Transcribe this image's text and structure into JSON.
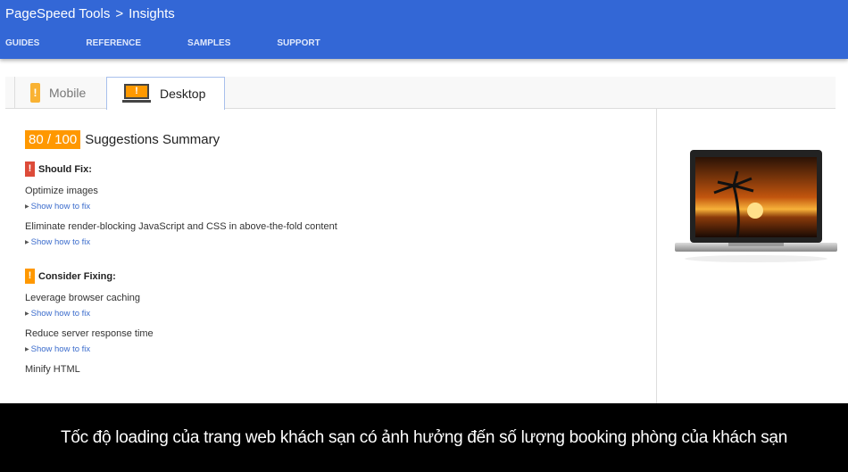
{
  "header": {
    "brand": "PageSpeed Tools",
    "separator": ">",
    "page": "Insights",
    "nav": [
      "GUIDES",
      "REFERENCE",
      "SAMPLES",
      "SUPPORT"
    ]
  },
  "tabs": [
    {
      "label": "Mobile",
      "icon": "phone-warning-icon"
    },
    {
      "label": "Desktop",
      "icon": "laptop-warning-icon",
      "active": true
    }
  ],
  "summary": {
    "score": "80 / 100",
    "title": "Suggestions Summary"
  },
  "should_fix": {
    "label": "Should Fix:",
    "color": "#dd4b39",
    "items": [
      "Optimize images",
      "Eliminate render-blocking JavaScript and CSS in above-the-fold content"
    ]
  },
  "consider_fixing": {
    "label": "Consider Fixing:",
    "color": "#ff9800",
    "items": [
      "Leverage browser caching",
      "Reduce server response time",
      "Minify HTML"
    ]
  },
  "show_fix": "Show how to fix",
  "caption": "Tốc độ loading của trang web khách sạn có ảnh hưởng đến số lượng booking phòng của khách sạn",
  "colors": {
    "header": "#3367d6",
    "score": "#ff9800",
    "link": "#3b6ccc"
  }
}
